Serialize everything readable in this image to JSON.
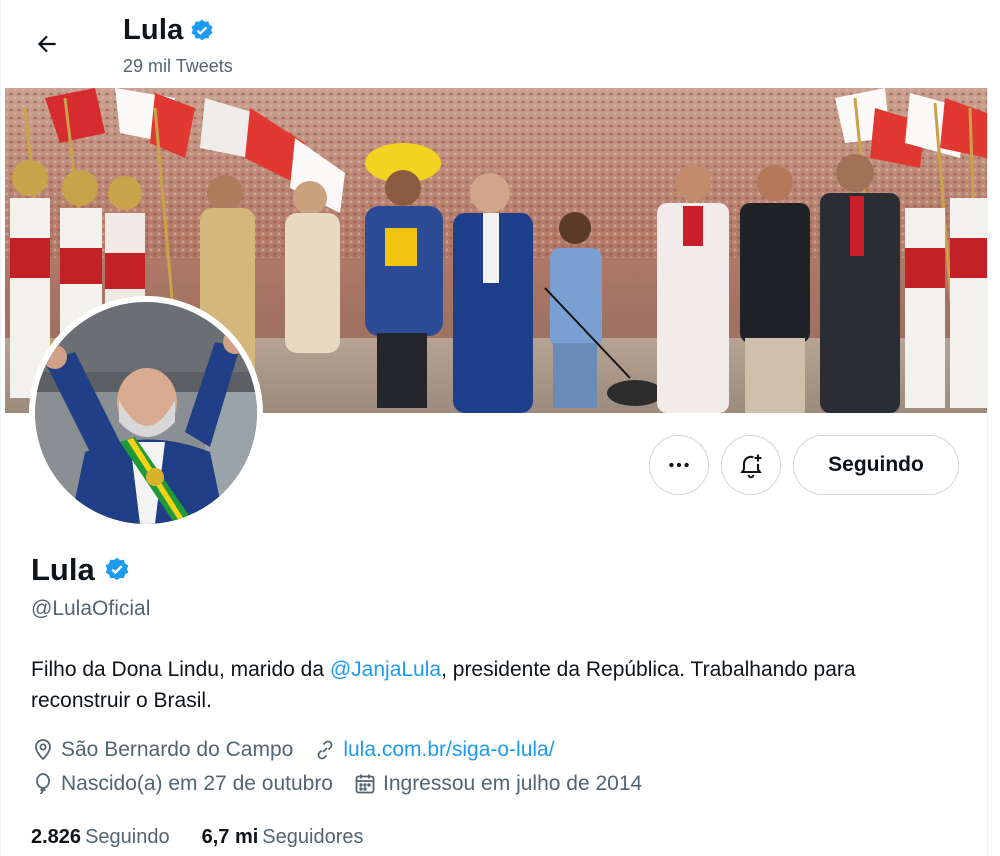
{
  "header": {
    "title": "Lula",
    "subtitle": "29 mil Tweets"
  },
  "actions": {
    "follow_label": "Seguindo"
  },
  "profile": {
    "name": "Lula",
    "handle": "@LulaOficial",
    "bio_part1": "Filho da Dona Lindu, marido da ",
    "bio_mention": "@JanjaLula",
    "bio_part2": ", presidente da República. Trabalhando para reconstruir o Brasil.",
    "location": "São Bernardo do Campo",
    "website": "lula.com.br/siga-o-lula/",
    "birthday": "Nascido(a) em 27 de outubro",
    "joined": "Ingressou em julho de 2014"
  },
  "stats": {
    "following_count": "2.826",
    "following_label": "Seguindo",
    "followers_count": "6,7 mi",
    "followers_label": "Seguidores"
  },
  "colors": {
    "accent": "#1d9bf0",
    "muted_text": "#536471",
    "border": "#cfd9de"
  },
  "icons": [
    "back-arrow-icon",
    "verified-badge-icon",
    "more-icon",
    "notification-bell-icon",
    "location-icon",
    "link-icon",
    "birthday-balloon-icon",
    "calendar-icon"
  ]
}
